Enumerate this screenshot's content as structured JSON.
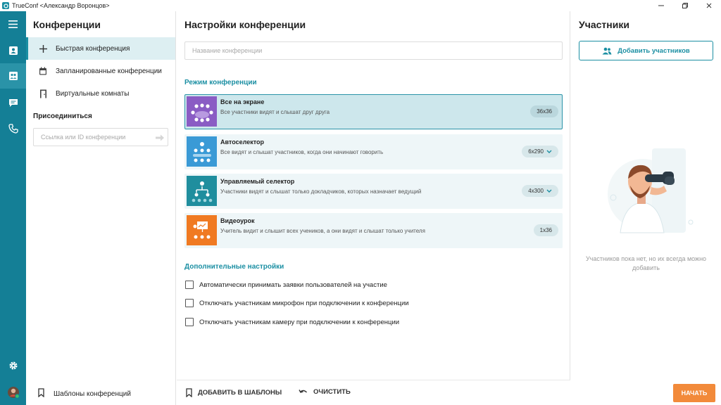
{
  "titlebar": {
    "title": "TrueConf <Александр Воронцов>"
  },
  "rail": {
    "items": [
      "menu-icon",
      "contacts-icon",
      "conferences-icon",
      "chat-icon",
      "calls-icon",
      "settings-icon",
      "avatar"
    ]
  },
  "sidebar": {
    "title": "Конференции",
    "items": [
      {
        "label": "Быстрая конференция",
        "icon": "plus-icon"
      },
      {
        "label": "Запланированные конференции",
        "icon": "calendar-icon"
      },
      {
        "label": "Виртуальные комнаты",
        "icon": "door-icon"
      }
    ],
    "join_label": "Присоединиться",
    "join_placeholder": "Ссылка или ID конференции",
    "templates_label": "Шаблоны конференций"
  },
  "main": {
    "title": "Настройки конференции",
    "name_placeholder": "Название конференции",
    "mode_section": "Режим конференции",
    "modes": [
      {
        "title": "Все на экране",
        "desc": "Все участники видят и слышат друг друга",
        "badge": "36x36",
        "color": "#8a5cc4",
        "selected": true
      },
      {
        "title": "Автоселектор",
        "desc": "Все видят и слышат участников, когда они начинают говорить",
        "badge": "6x290",
        "color": "#3a9ad6",
        "selected": false
      },
      {
        "title": "Управляемый селектор",
        "desc": "Участники видят и слышат только докладчиков, которых назначает ведущий",
        "badge": "4x300",
        "color": "#1f8e9e",
        "selected": false
      },
      {
        "title": "Видеоурок",
        "desc": "Учитель видит и слышит всех учеников, а они видят и слышат только учителя",
        "badge": "1x36",
        "color": "#f07a22",
        "selected": false
      }
    ],
    "extra_section": "Дополнительные настройки",
    "options": [
      "Автоматически принимать заявки пользователей на участие",
      "Отключать участникам микрофон при подключении к конференции",
      "Отключать участникам камеру при подключении к конференции"
    ],
    "footer": {
      "add_template": "ДОБАВИТЬ В ШАБЛОНЫ",
      "clear": "ОЧИСТИТЬ"
    }
  },
  "participants": {
    "title": "Участники",
    "add_button": "Добавить участников",
    "empty_note": "Участников пока нет, но их всегда можно добавить",
    "start_button": "НАЧАТЬ"
  },
  "colors": {
    "accent": "#1b8fa3",
    "rail": "#147f96",
    "start": "#f28a3a"
  }
}
